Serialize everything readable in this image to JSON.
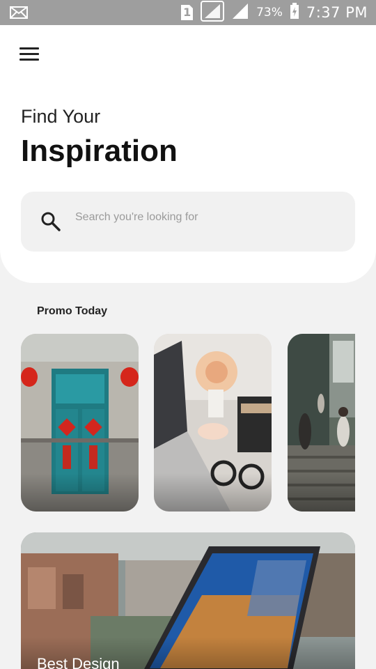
{
  "status_bar": {
    "sim_label": "1",
    "battery_percent": "73%",
    "time": "7:37 PM",
    "icons": [
      "mail-icon",
      "sim-icon",
      "signal-icon",
      "signal-icon",
      "battery-charging-icon"
    ]
  },
  "header": {
    "menu_icon": "hamburger-menu-icon",
    "subtitle": "Find Your",
    "title": "Inspiration"
  },
  "search": {
    "icon": "search-icon",
    "placeholder": "Search you're looking for"
  },
  "promo": {
    "section_title": "Promo Today",
    "cards": [
      {
        "image": "teal door with red lanterns"
      },
      {
        "image": "desk with laptop, flowers and sunglasses"
      },
      {
        "image": "street stairs with people"
      }
    ]
  },
  "feature": {
    "title": "Best Design",
    "image": "laptop over city view"
  },
  "colors": {
    "background": "#f2f2f2",
    "surface": "#ffffff",
    "search_bg": "#f1f1f1",
    "text_primary": "#111111",
    "status_bar": "#9e9e9e"
  }
}
